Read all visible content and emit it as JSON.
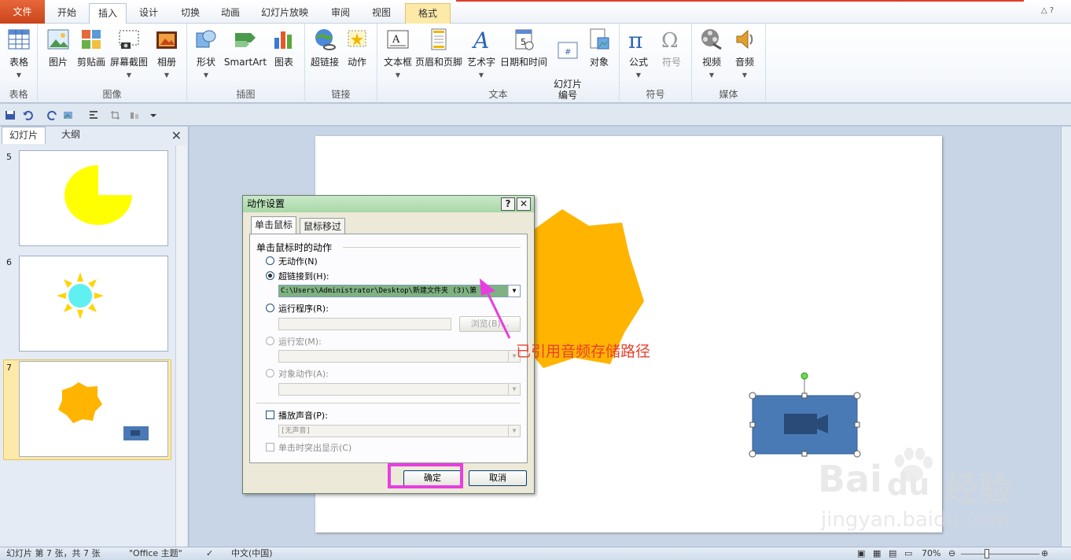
{
  "tabs": [
    {
      "label": "文件"
    },
    {
      "label": "开始"
    },
    {
      "label": "插入"
    },
    {
      "label": "设计"
    },
    {
      "label": "切换"
    },
    {
      "label": "动画"
    },
    {
      "label": "幻灯片放映"
    },
    {
      "label": "审阅"
    },
    {
      "label": "视图"
    },
    {
      "label": "格式"
    }
  ],
  "help_glyph": "△ ?",
  "ribbon": {
    "groups": [
      {
        "label": "表格",
        "buttons": [
          {
            "label": "表格",
            "icon": "table-icon"
          }
        ]
      },
      {
        "label": "图像",
        "buttons": [
          {
            "label": "图片",
            "icon": "picture-icon"
          },
          {
            "label": "剪贴画",
            "icon": "clipart-icon"
          },
          {
            "label": "屏幕截图",
            "icon": "screenshot-icon"
          },
          {
            "label": "相册",
            "icon": "album-icon"
          }
        ]
      },
      {
        "label": "插图",
        "buttons": [
          {
            "label": "形状",
            "icon": "shapes-icon"
          },
          {
            "label": "SmartArt",
            "icon": "smartart-icon"
          },
          {
            "label": "图表",
            "icon": "chart-icon"
          }
        ]
      },
      {
        "label": "链接",
        "buttons": [
          {
            "label": "超链接",
            "icon": "hyperlink-icon"
          },
          {
            "label": "动作",
            "icon": "action-icon"
          }
        ]
      },
      {
        "label": "文本",
        "buttons": [
          {
            "label": "文本框",
            "icon": "textbox-icon"
          },
          {
            "label": "页眉和页脚",
            "icon": "header-footer-icon"
          },
          {
            "label": "艺术字",
            "icon": "wordart-icon"
          },
          {
            "label": "日期和时间",
            "icon": "datetime-icon"
          },
          {
            "label": "幻灯片\n编号",
            "icon": "slide-number-icon"
          },
          {
            "label": "对象",
            "icon": "object-icon"
          }
        ]
      },
      {
        "label": "符号",
        "buttons": [
          {
            "label": "公式",
            "icon": "equation-icon"
          },
          {
            "label": "符号",
            "icon": "symbol-icon"
          }
        ]
      },
      {
        "label": "媒体",
        "buttons": [
          {
            "label": "视频",
            "icon": "video-icon"
          },
          {
            "label": "音频",
            "icon": "audio-icon"
          }
        ]
      }
    ]
  },
  "left_pane": {
    "tabs": [
      {
        "label": "幻灯片"
      },
      {
        "label": "大纲"
      }
    ],
    "close_glyph": "✕",
    "slides": [
      {
        "number": "5"
      },
      {
        "number": "6"
      },
      {
        "number": "7"
      }
    ]
  },
  "dialog": {
    "title": "动作设置",
    "help_glyph": "?",
    "close_glyph": "✕",
    "tabs": [
      {
        "label": "单击鼠标"
      },
      {
        "label": "鼠标移过"
      }
    ],
    "section_title": "单击鼠标时的动作",
    "options": {
      "none": "无动作(N)",
      "hyperlink": "超链接到(H):",
      "run_program": "运行程序(R):",
      "run_macro": "运行宏(M):",
      "object_action": "对象动作(A):"
    },
    "hyperlink_value": "C:\\Users\\Administrator\\Desktop\\新建文件夹 (3)\\第",
    "browse_label": "浏览(B)...",
    "play_sound": "播放声音(P):",
    "sound_value": "[无声音]",
    "highlight_click": "单击时突出显示(C)",
    "ok_label": "确定",
    "cancel_label": "取消",
    "dropdown_glyph": "▼"
  },
  "annotation": "已引用音频存储路径",
  "status": {
    "slide_info": "幻灯片 第 7 张，共 7 张",
    "theme": "\"Office 主题\"",
    "language": "中文(中国)",
    "zoom": "70%"
  },
  "watermark": {
    "brand": "Bai",
    "brand2": "du",
    "cn": "经验",
    "url": "jingyan.baidu.com"
  },
  "colors": {
    "accent_orange": "#ffb400",
    "pie_yellow": "#ffff00",
    "sun_cyan": "#5ff0f0",
    "video_blue": "#4a7ab5",
    "highlight_magenta": "#e83ee0",
    "annotation_red": "#e8402c"
  }
}
